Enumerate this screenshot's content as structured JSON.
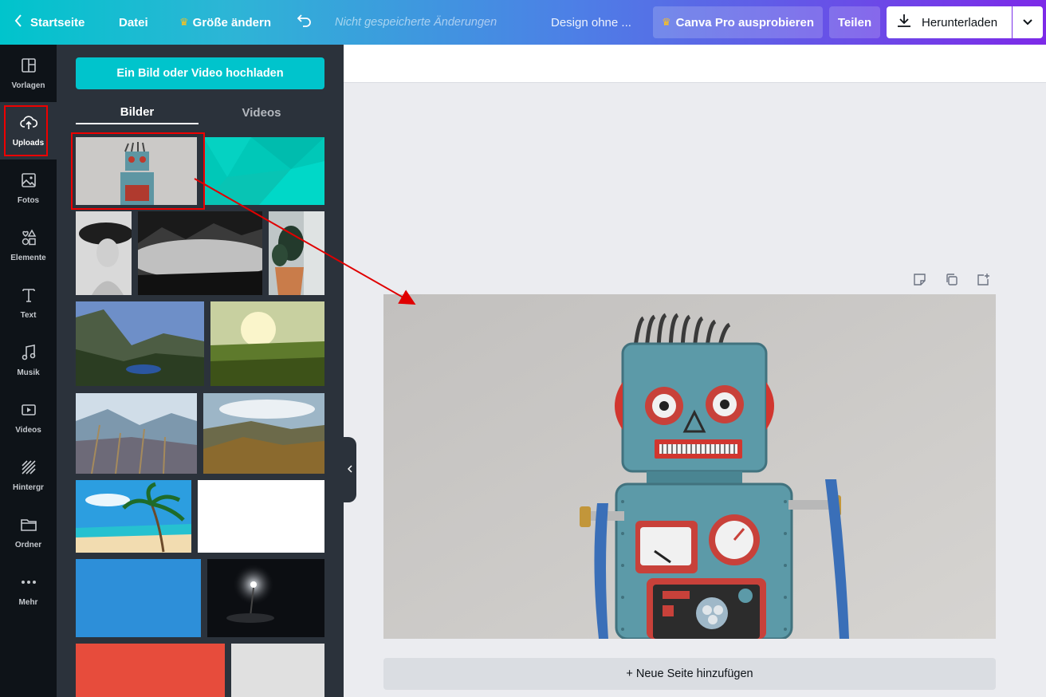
{
  "topbar": {
    "home_label": "Startseite",
    "file_label": "Datei",
    "resize_label": "Größe ändern",
    "unsaved_label": "Nicht gespeicherte Änderungen",
    "design_title": "Design ohne ...",
    "pro_label": "Canva Pro ausprobieren",
    "share_label": "Teilen",
    "download_label": "Herunterladen"
  },
  "rail": {
    "items": [
      {
        "label": "Vorlagen",
        "icon": "templates-icon"
      },
      {
        "label": "Uploads",
        "icon": "cloud-upload-icon"
      },
      {
        "label": "Fotos",
        "icon": "photo-icon"
      },
      {
        "label": "Elemente",
        "icon": "shapes-icon"
      },
      {
        "label": "Text",
        "icon": "text-icon"
      },
      {
        "label": "Musik",
        "icon": "music-icon"
      },
      {
        "label": "Videos",
        "icon": "video-icon"
      },
      {
        "label": "Hintergr",
        "icon": "background-icon"
      },
      {
        "label": "Ordner",
        "icon": "folder-icon"
      },
      {
        "label": "Mehr",
        "icon": "more-icon"
      }
    ],
    "active": "Uploads"
  },
  "panel": {
    "upload_button": "Ein Bild oder Video hochladen",
    "tabs": [
      {
        "label": "Bilder",
        "active": true
      },
      {
        "label": "Videos",
        "active": false
      }
    ],
    "thumbnails": [
      "robot-photo",
      "teal-polygon",
      "woman-hat-bw",
      "foggy-mountains-bw",
      "plant-pot",
      "mountain-lake-valley",
      "sunset-grass",
      "mountains-grass",
      "hills-sunlight",
      "palm-beach",
      "white",
      "blue",
      "night-lamp",
      "red",
      "light-gray"
    ]
  },
  "canvas": {
    "add_page_label": "+ Neue Seite hinzufügen",
    "page_icons": [
      "note-icon",
      "duplicate-icon",
      "add-page-icon"
    ]
  },
  "colors": {
    "accent_teal": "#00c4cc",
    "gradient_end": "#7d2ae8",
    "panel_bg": "#2b323b",
    "rail_bg": "#0e1318",
    "annotation_red": "#e00000"
  }
}
